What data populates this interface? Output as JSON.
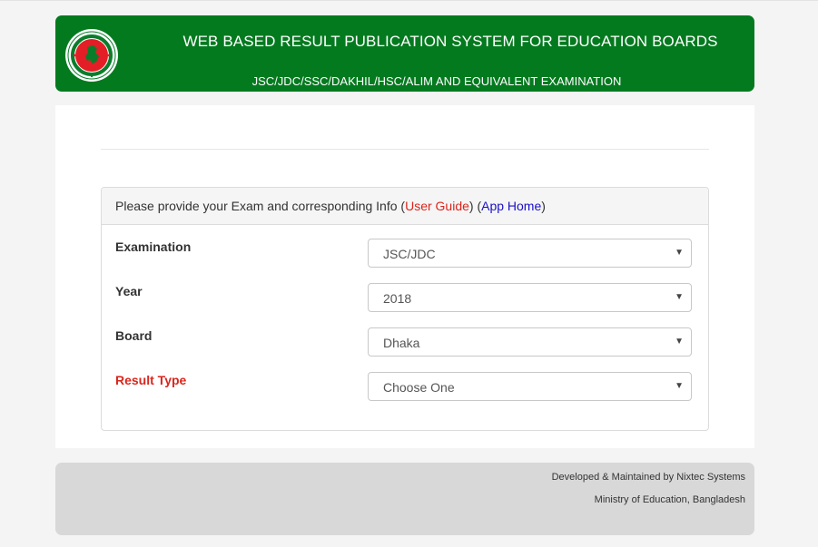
{
  "header": {
    "title": "WEB BASED RESULT PUBLICATION SYSTEM FOR EDUCATION BOARDS",
    "subtitle": "JSC/JDC/SSC/DAKHIL/HSC/ALIM AND EQUIVALENT EXAMINATION",
    "logo_icon": "government-seal-icon"
  },
  "panel": {
    "prompt": "Please provide your Exam and corresponding Info",
    "open_paren": "(",
    "user_guide": "User Guide",
    "close_mid": ") (",
    "app_home": "App Home",
    "close_paren": ")"
  },
  "form": {
    "examination": {
      "label": "Examination",
      "value": "JSC/JDC"
    },
    "year": {
      "label": "Year",
      "value": "2018"
    },
    "board": {
      "label": "Board",
      "value": "Dhaka"
    },
    "result_type": {
      "label": "Result Type",
      "value": "Choose One"
    },
    "caret": "▼"
  },
  "footer": {
    "line1": "Developed & Maintained by Nixtec Systems",
    "line2": "Ministry of Education, Bangladesh"
  },
  "colors": {
    "header_green": "#047a1f",
    "accent_red": "#d9261c",
    "link_blue": "#1a10c8",
    "footer_gray": "#d8d8d8"
  }
}
